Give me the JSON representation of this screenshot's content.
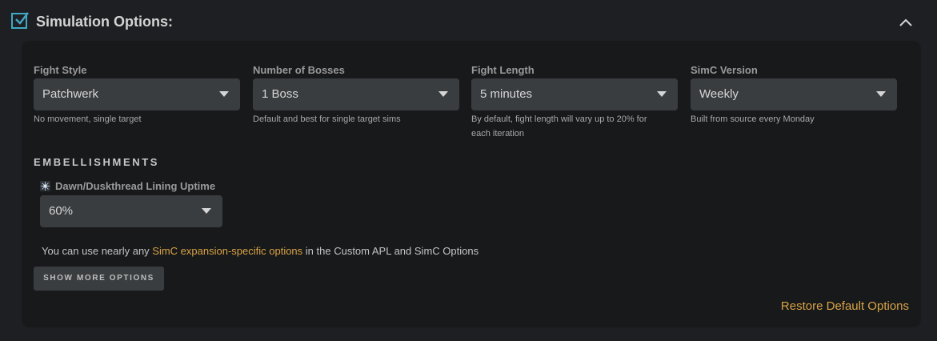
{
  "header": {
    "title": "Simulation Options:",
    "checkbox_checked": true,
    "collapse_icon": "chevron-up-icon"
  },
  "fields": [
    {
      "label": "Fight Style",
      "value": "Patchwerk",
      "help": "No movement, single target"
    },
    {
      "label": "Number of Bosses",
      "value": "1 Boss",
      "help": "Default and best for single target sims"
    },
    {
      "label": "Fight Length",
      "value": "5 minutes",
      "help": "By default, fight length will vary up to 20% for each iteration"
    },
    {
      "label": "SimC Version",
      "value": "Weekly",
      "help": "Built from source every Monday"
    }
  ],
  "embellishments": {
    "heading": "EMBELLISHMENTS",
    "item_label": "Dawn/Duskthread Lining Uptime",
    "item_icon": "dawn-duskthread-icon",
    "value": "60%"
  },
  "info": {
    "prefix": "You can use nearly any ",
    "link": "SimC expansion-specific options",
    "suffix": " in the Custom APL and SimC Options"
  },
  "buttons": {
    "show_more": "SHOW MORE OPTIONS",
    "restore": "Restore Default Options"
  },
  "colors": {
    "accent_teal": "#3ea9c4",
    "link_gold": "#d9a441",
    "panel_bg": "#18191b",
    "page_bg": "#1e1f22",
    "select_bg": "#3a3d40"
  }
}
